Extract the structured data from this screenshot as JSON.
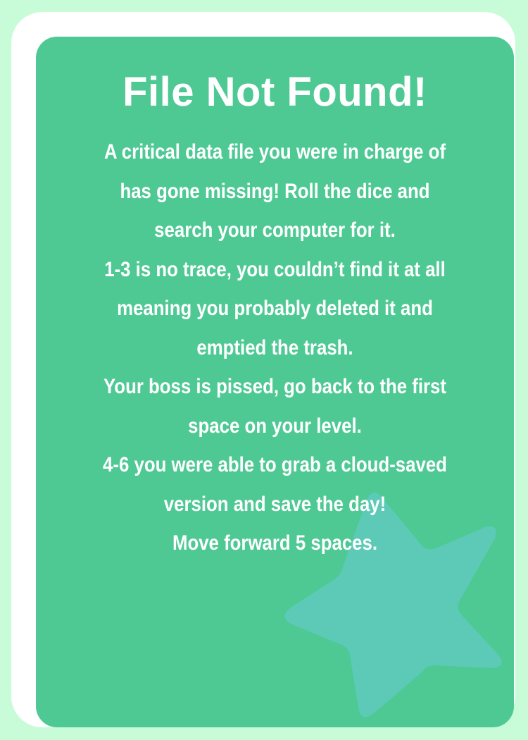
{
  "card": {
    "title": "File Not Found!",
    "lines": [
      "A critical data file you were in charge of",
      "has gone missing! Roll the dice and",
      "search your computer for it.",
      "1-3 is no trace, you couldn’t find it at all",
      "meaning you probably deleted it and",
      "emptied the trash.",
      "Your boss is pissed, go back to the first",
      "space on your level.",
      "4-6 you were able to grab a cloud-saved",
      "version and save the day!",
      "Move forward 5 spaces."
    ]
  },
  "colors": {
    "background": "#c8fbd7",
    "border": "#ffffff",
    "card": "#4ec994",
    "star": "#5ccab6",
    "text": "#ffffff"
  },
  "icons": {
    "decoration": "star-icon"
  }
}
